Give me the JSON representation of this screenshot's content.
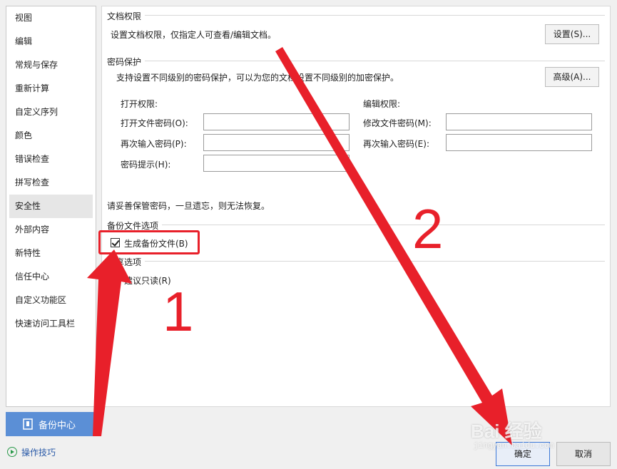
{
  "sidebar": {
    "items": [
      {
        "label": "视图"
      },
      {
        "label": "编辑"
      },
      {
        "label": "常规与保存"
      },
      {
        "label": "重新计算"
      },
      {
        "label": "自定义序列"
      },
      {
        "label": "颜色"
      },
      {
        "label": "错误检查"
      },
      {
        "label": "拼写检查"
      },
      {
        "label": "安全性"
      },
      {
        "label": "外部内容"
      },
      {
        "label": "新特性"
      },
      {
        "label": "信任中心"
      },
      {
        "label": "自定义功能区"
      },
      {
        "label": "快速访问工具栏"
      }
    ],
    "active": "安全性",
    "backup_label": "备份中心",
    "tips_label": "操作技巧"
  },
  "doc_permission": {
    "title": "文档权限",
    "desc": "设置文档权限，仅指定人可查看/编辑文档。",
    "button": "设置(S)..."
  },
  "password": {
    "title": "密码保护",
    "desc": "支持设置不同级别的密码保护，可以为您的文档设置不同级别的加密保护。",
    "button": "高级(A)...",
    "open_header": "打开权限:",
    "open_pwd_label": "打开文件密码(O):",
    "open_confirm_label": "再次输入密码(P):",
    "hint_label": "密码提示(H):",
    "edit_header": "编辑权限:",
    "edit_pwd_label": "修改文件密码(M):",
    "edit_confirm_label": "再次输入密码(E):",
    "warning": "请妥善保管密码，一旦遗忘，则无法恢复。"
  },
  "backup": {
    "title": "备份文件选项",
    "checkbox_label": "生成备份文件(B)",
    "checked": true
  },
  "share": {
    "title": "共享选项",
    "readonly_label": "建议只读(R)"
  },
  "footer": {
    "ok": "确定",
    "cancel": "取消"
  },
  "annotations": {
    "step1": "1",
    "step2": "2",
    "color": "#e8202a"
  },
  "watermark": {
    "brand": "Bai 经验",
    "url": "jingyan.baidu.com"
  }
}
